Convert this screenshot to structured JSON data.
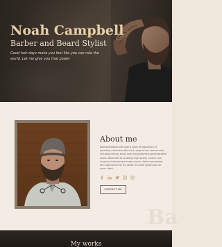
{
  "hero": {
    "name": "Noah Campbell",
    "subtitle": "Barber and Beard Stylist",
    "tagline": "Good hair days make you feel like you can rule the world. Let me give you that power"
  },
  "about": {
    "heading": "About me",
    "body": "Diamond Barber with over 6 years of experience of providing customers with a full range of hair care services including cutting, beard care and performing administrative duties. Dedicated to providing high quality custom cuts. Loved and has become known by his clients everywhere. He is well-known for his ability to create great looks for every client.",
    "socials": [
      "facebook-icon",
      "linkedin-icon",
      "twitter-icon",
      "instagram-icon",
      "dribbble-icon"
    ],
    "contact_label": "CONTACT ME",
    "watermark": "Ba"
  },
  "works": {
    "title": "My works"
  },
  "colors": {
    "accent": "#e7cfa8",
    "hero_bg": "#332c26",
    "about_bg": "#f2ece5",
    "frame": "#8a7d70",
    "icon": "#c2a67e"
  }
}
